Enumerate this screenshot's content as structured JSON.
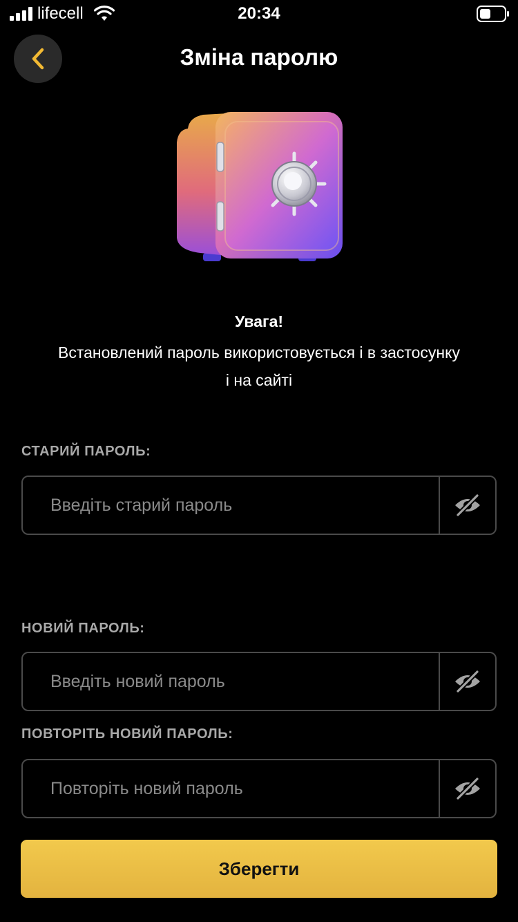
{
  "status_bar": {
    "carrier": "lifecell",
    "time": "20:34"
  },
  "header": {
    "title": "Зміна паролю",
    "back_icon": "chevron-left-icon",
    "accent_color": "#f2b933"
  },
  "illustration": {
    "icon": "safe-illustration"
  },
  "notice": {
    "title": "Увага!",
    "text": "Встановлений пароль використовується і в застосунку і на сайті"
  },
  "form": {
    "old_password": {
      "label": "СТАРИЙ ПАРОЛЬ:",
      "value": "",
      "placeholder": "Введіть старий пароль",
      "toggle_icon": "eye-slash-icon"
    },
    "new_password": {
      "label": "НОВИЙ ПАРОЛЬ:",
      "value": "",
      "placeholder": "Введіть новий пароль",
      "toggle_icon": "eye-slash-icon"
    },
    "repeat_password": {
      "label": "ПОВТОРІТЬ НОВИЙ ПАРОЛЬ:",
      "value": "",
      "placeholder": "Повторіть новий пароль",
      "toggle_icon": "eye-slash-icon"
    }
  },
  "save_button": {
    "label": "Зберегти",
    "color": "#f0c24a"
  }
}
